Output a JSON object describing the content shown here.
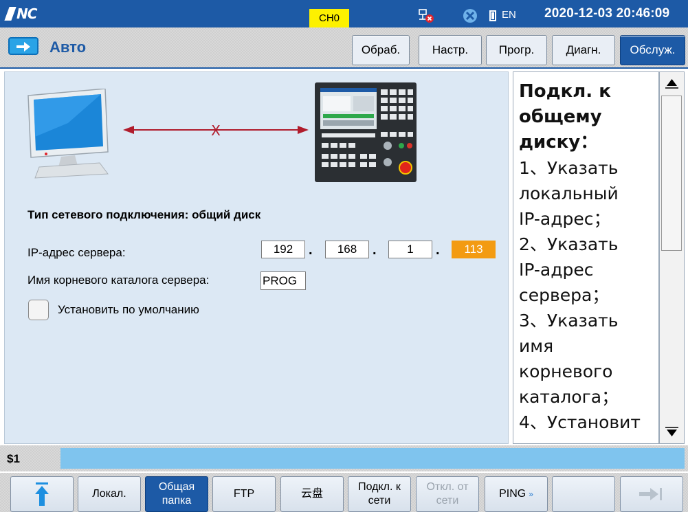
{
  "topbar": {
    "logo_text": "NC",
    "channel": "CH0",
    "lang": "EN",
    "datetime": "2020-12-03 20:46:09",
    "accent_color": "#1d5aa6",
    "channel_color": "#fdf100"
  },
  "titlebar": {
    "mode": "Авто",
    "tabs": [
      {
        "label": "Обраб.",
        "active": false
      },
      {
        "label": "Настр.",
        "active": false
      },
      {
        "label": "Прогр.",
        "active": false
      },
      {
        "label": "Диагн.",
        "active": false
      },
      {
        "label": "Обслуж.",
        "active": true
      }
    ]
  },
  "main": {
    "connection_type": "Тип сетевого подключения: общий диск",
    "ip_label": "IP-адрес сервера:",
    "ip": [
      "192",
      "168",
      "1",
      "113"
    ],
    "root_label": "Имя корневого каталога сервера:",
    "root_value": "PROG",
    "default_label": "Установить по умолчанию",
    "default_checked": false,
    "link_status_mark": "X",
    "selected_ip_color": "#f39b12"
  },
  "help": {
    "title_lines": [
      "Подкл. к",
      "общему",
      "диску："
    ],
    "lines": [
      "1、Указать",
      "локальный",
      "IP-адрес；",
      "2、Указать",
      "IP-адрес",
      "сервера；",
      "3、Указать",
      "имя",
      "корневого",
      "каталога；",
      "4、Установит"
    ]
  },
  "cmdline": {
    "label": "$1",
    "value": ""
  },
  "softkeys": [
    {
      "name": "softkey-up",
      "label": "",
      "icon": "up-arrow-icon",
      "active": false,
      "disabled": false
    },
    {
      "name": "softkey-local",
      "label": "Локал.",
      "active": false,
      "disabled": false
    },
    {
      "name": "softkey-shared-folder",
      "label": "Общая папка",
      "active": true,
      "disabled": false
    },
    {
      "name": "softkey-ftp",
      "label": "FTP",
      "active": false,
      "disabled": false
    },
    {
      "name": "softkey-cloud",
      "label": "云盘",
      "active": false,
      "disabled": false
    },
    {
      "name": "softkey-connect",
      "label": "Подкл. к сети",
      "active": false,
      "disabled": false
    },
    {
      "name": "softkey-disconnect",
      "label": "Откл. от сети",
      "active": false,
      "disabled": true
    },
    {
      "name": "softkey-ping",
      "label": "PING",
      "icon": "double-chevron-down-icon",
      "active": false,
      "disabled": false
    },
    {
      "name": "softkey-empty",
      "label": "",
      "active": false,
      "disabled": false
    },
    {
      "name": "softkey-next",
      "label": "",
      "icon": "next-page-arrow-icon",
      "active": false,
      "disabled": false
    }
  ]
}
